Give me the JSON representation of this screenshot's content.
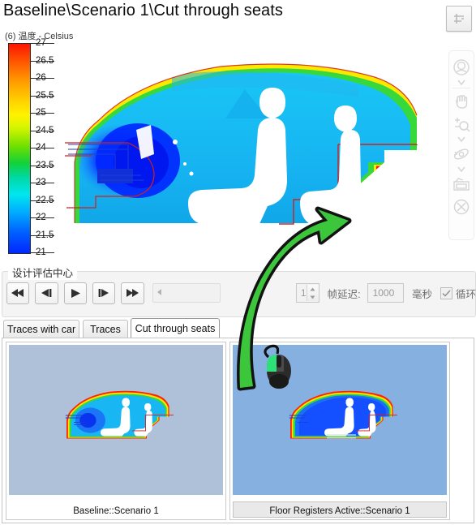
{
  "window": {
    "title": "Baseline\\Scenario 1\\Cut through seats"
  },
  "viewport": {
    "legend_label": "(6) 温度 - Celsius",
    "colorbar": {
      "ticks": [
        "27",
        "26.5",
        "26",
        "25.5",
        "25",
        "24.5",
        "24",
        "23.5",
        "23",
        "22.5",
        "22",
        "21.5",
        "21"
      ],
      "max": 27,
      "min": 21,
      "unit": "Celsius"
    },
    "toolbar_top": {
      "button_name": "view-orientation-button"
    },
    "toolbar_side": {
      "items": [
        {
          "name": "view-sphere-icon"
        },
        {
          "name": "chevron-down-icon"
        },
        {
          "name": "hand-pan-icon"
        },
        {
          "name": "zoom-in-out-icon"
        },
        {
          "name": "chevron-down-icon"
        },
        {
          "name": "orbit-rotate-icon"
        },
        {
          "name": "chevron-down-icon"
        },
        {
          "name": "camera-snapshot-icon"
        },
        {
          "name": "close-circle-icon"
        }
      ]
    }
  },
  "player": {
    "group_title": "设计评估中心",
    "buttons": [
      {
        "name": "skip-to-start-button",
        "glyph": "◀◀"
      },
      {
        "name": "step-back-button",
        "glyph": "◀|"
      },
      {
        "name": "play-button",
        "glyph": "▶"
      },
      {
        "name": "step-forward-button",
        "glyph": "|▶"
      },
      {
        "name": "skip-to-end-button",
        "glyph": "▶▶"
      }
    ],
    "frame_value": "1",
    "delay_label": "帧延迟:",
    "delay_value": "1000",
    "delay_unit": "毫秒",
    "loop_label": "循环",
    "loop_checked": true
  },
  "tabs": [
    {
      "label": "Traces with car",
      "active": false
    },
    {
      "label": "Traces",
      "active": false
    },
    {
      "label": "Cut through seats",
      "active": true
    }
  ],
  "thumbnails": [
    {
      "caption": "Baseline::Scenario 1",
      "selected": false,
      "bg": "#aec1d8"
    },
    {
      "caption": "Floor Registers Active::Scenario 1",
      "selected": true,
      "bg": "#86b0e0"
    }
  ],
  "annotation": {
    "arrow_color": "#3cc63c",
    "arrow_outline": "#131313",
    "cursor_name": "mouse-cursor-icon"
  },
  "colors": {
    "hot": "#ff1500",
    "cold": "#0027ff",
    "outline": "#d02020",
    "selected_thumb_header": "#6aa2dd"
  }
}
